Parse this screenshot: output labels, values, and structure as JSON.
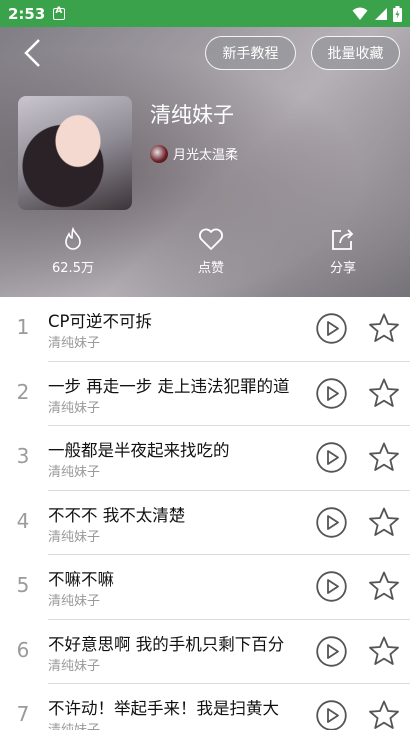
{
  "status_bar": {
    "time": "2:53"
  },
  "header": {
    "tutorial_label": "新手教程",
    "batch_collect_label": "批量收藏",
    "playlist_title": "清纯妹子",
    "creator_name": "月光太温柔"
  },
  "stats": {
    "plays": "62.5万",
    "like": "点赞",
    "share": "分享"
  },
  "songs": [
    {
      "index": "1",
      "title": "CP可逆不可拆",
      "artist": "清纯妹子"
    },
    {
      "index": "2",
      "title": "一步 再走一步 走上违法犯罪的道",
      "artist": "清纯妹子"
    },
    {
      "index": "3",
      "title": "一般都是半夜起来找吃的",
      "artist": "清纯妹子"
    },
    {
      "index": "4",
      "title": "不不不 我不太清楚",
      "artist": "清纯妹子"
    },
    {
      "index": "5",
      "title": "不嘛不嘛",
      "artist": "清纯妹子"
    },
    {
      "index": "6",
      "title": "不好意思啊 我的手机只剩下百分",
      "artist": "清纯妹子"
    },
    {
      "index": "7",
      "title": "不许动！举起手来！我是扫黄大",
      "artist": "清纯妹子"
    }
  ],
  "colors": {
    "status_bar": "#3aa24a",
    "icon_gray": "#555555"
  }
}
